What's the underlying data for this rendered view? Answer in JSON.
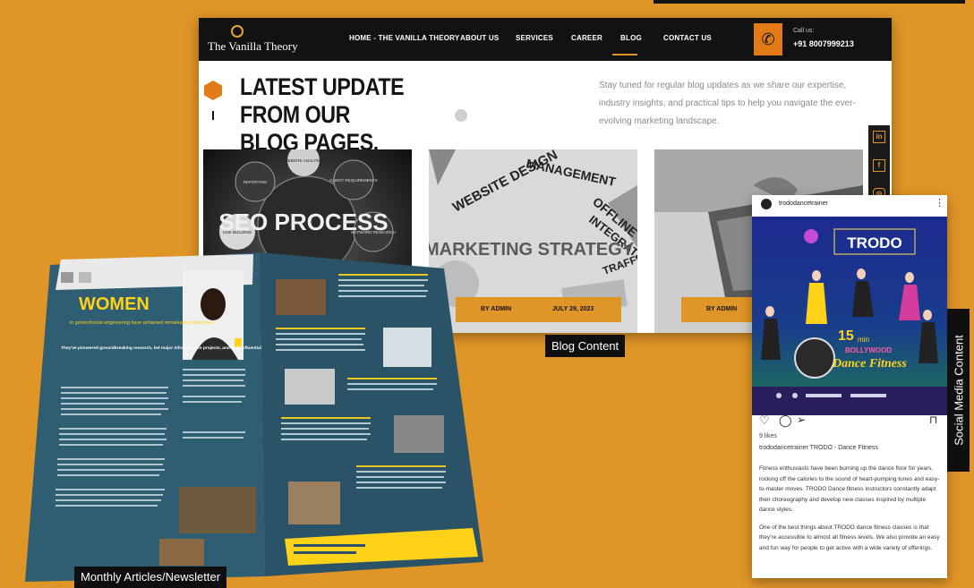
{
  "website": {
    "logo_text": "The Vanilla Theory",
    "nav_items": [
      "HOME - THE VANILLA THEORY",
      "ABOUT US",
      "SERVICES",
      "CAREER",
      "BLOG",
      "CONTACT US"
    ],
    "active_nav": "BLOG",
    "call_label": "Call us:",
    "call_number": "+91 8007999213",
    "hero_title_line1": "LATEST UPDATE FROM OUR",
    "hero_title_line2": "BLOG PAGES.",
    "hero_description": "Stay tuned for regular blog updates as we share our expertise, industry insights, and practical tips to help you navigate the ever-evolving marketing landscape.",
    "social_icons": [
      "linkedin-icon",
      "facebook-icon",
      "instagram-icon"
    ],
    "cards": [
      {
        "image_text": "SEO PROCESS",
        "bubbles": [
          "WEBSITE ANALYSIS",
          "REPORTING",
          "CLIENT REQUIREMENTS",
          "LINK BUILDING",
          "KEYWORD RESEARCH"
        ]
      },
      {
        "image_text": "MARKETING STRATEGY",
        "words": [
          "WEBSITE DESIGN",
          "MANAGEMENT",
          "OFFLINE",
          "INTEGRATION",
          "TRAFFIC BUILDING"
        ],
        "author": "BY ADMIN",
        "date": "JULY 29, 2023"
      },
      {
        "author": "BY ADMIN"
      }
    ]
  },
  "labels": {
    "blog_content": "Blog Content",
    "monthly_articles": "Monthly Articles/Newsletter",
    "social_media": "Social Media Content"
  },
  "magazine": {
    "headline": "WOMEN",
    "subheadline": "in geotechnical engineering have achieved remarkable milestones",
    "lead": "They've pioneered groundbreaking research, led major infrastructure projects, and held influential leadership roles"
  },
  "instagram": {
    "username": "trododancetrainer",
    "brand": "TRODO",
    "badge_number": "15",
    "badge_unit": "min",
    "badge_line": "BOLLYWOOD",
    "badge_title": "Dance Fitness",
    "likes": "9 likes",
    "caption": "trododancetrainer TRODO - Dance Fitness",
    "body_p1": "Fitness enthusiasts have been burning up the dance floor for years, rocking off the calories to the sound of heart-pumping tunes and easy-to-master moves. TRODO Dance fitness instructors constantly adapt their choreography and develop new classes inspired by multiple dance styles.",
    "body_p2": "One of the best things about TRODO dance fitness classes is that they're accessible to almost all fitness levels. We also provide an easy and fun way for people to get active with a wide variety of offerings."
  },
  "colors": {
    "background": "#E09527",
    "accent": "#E07B17",
    "dark": "#121212"
  }
}
